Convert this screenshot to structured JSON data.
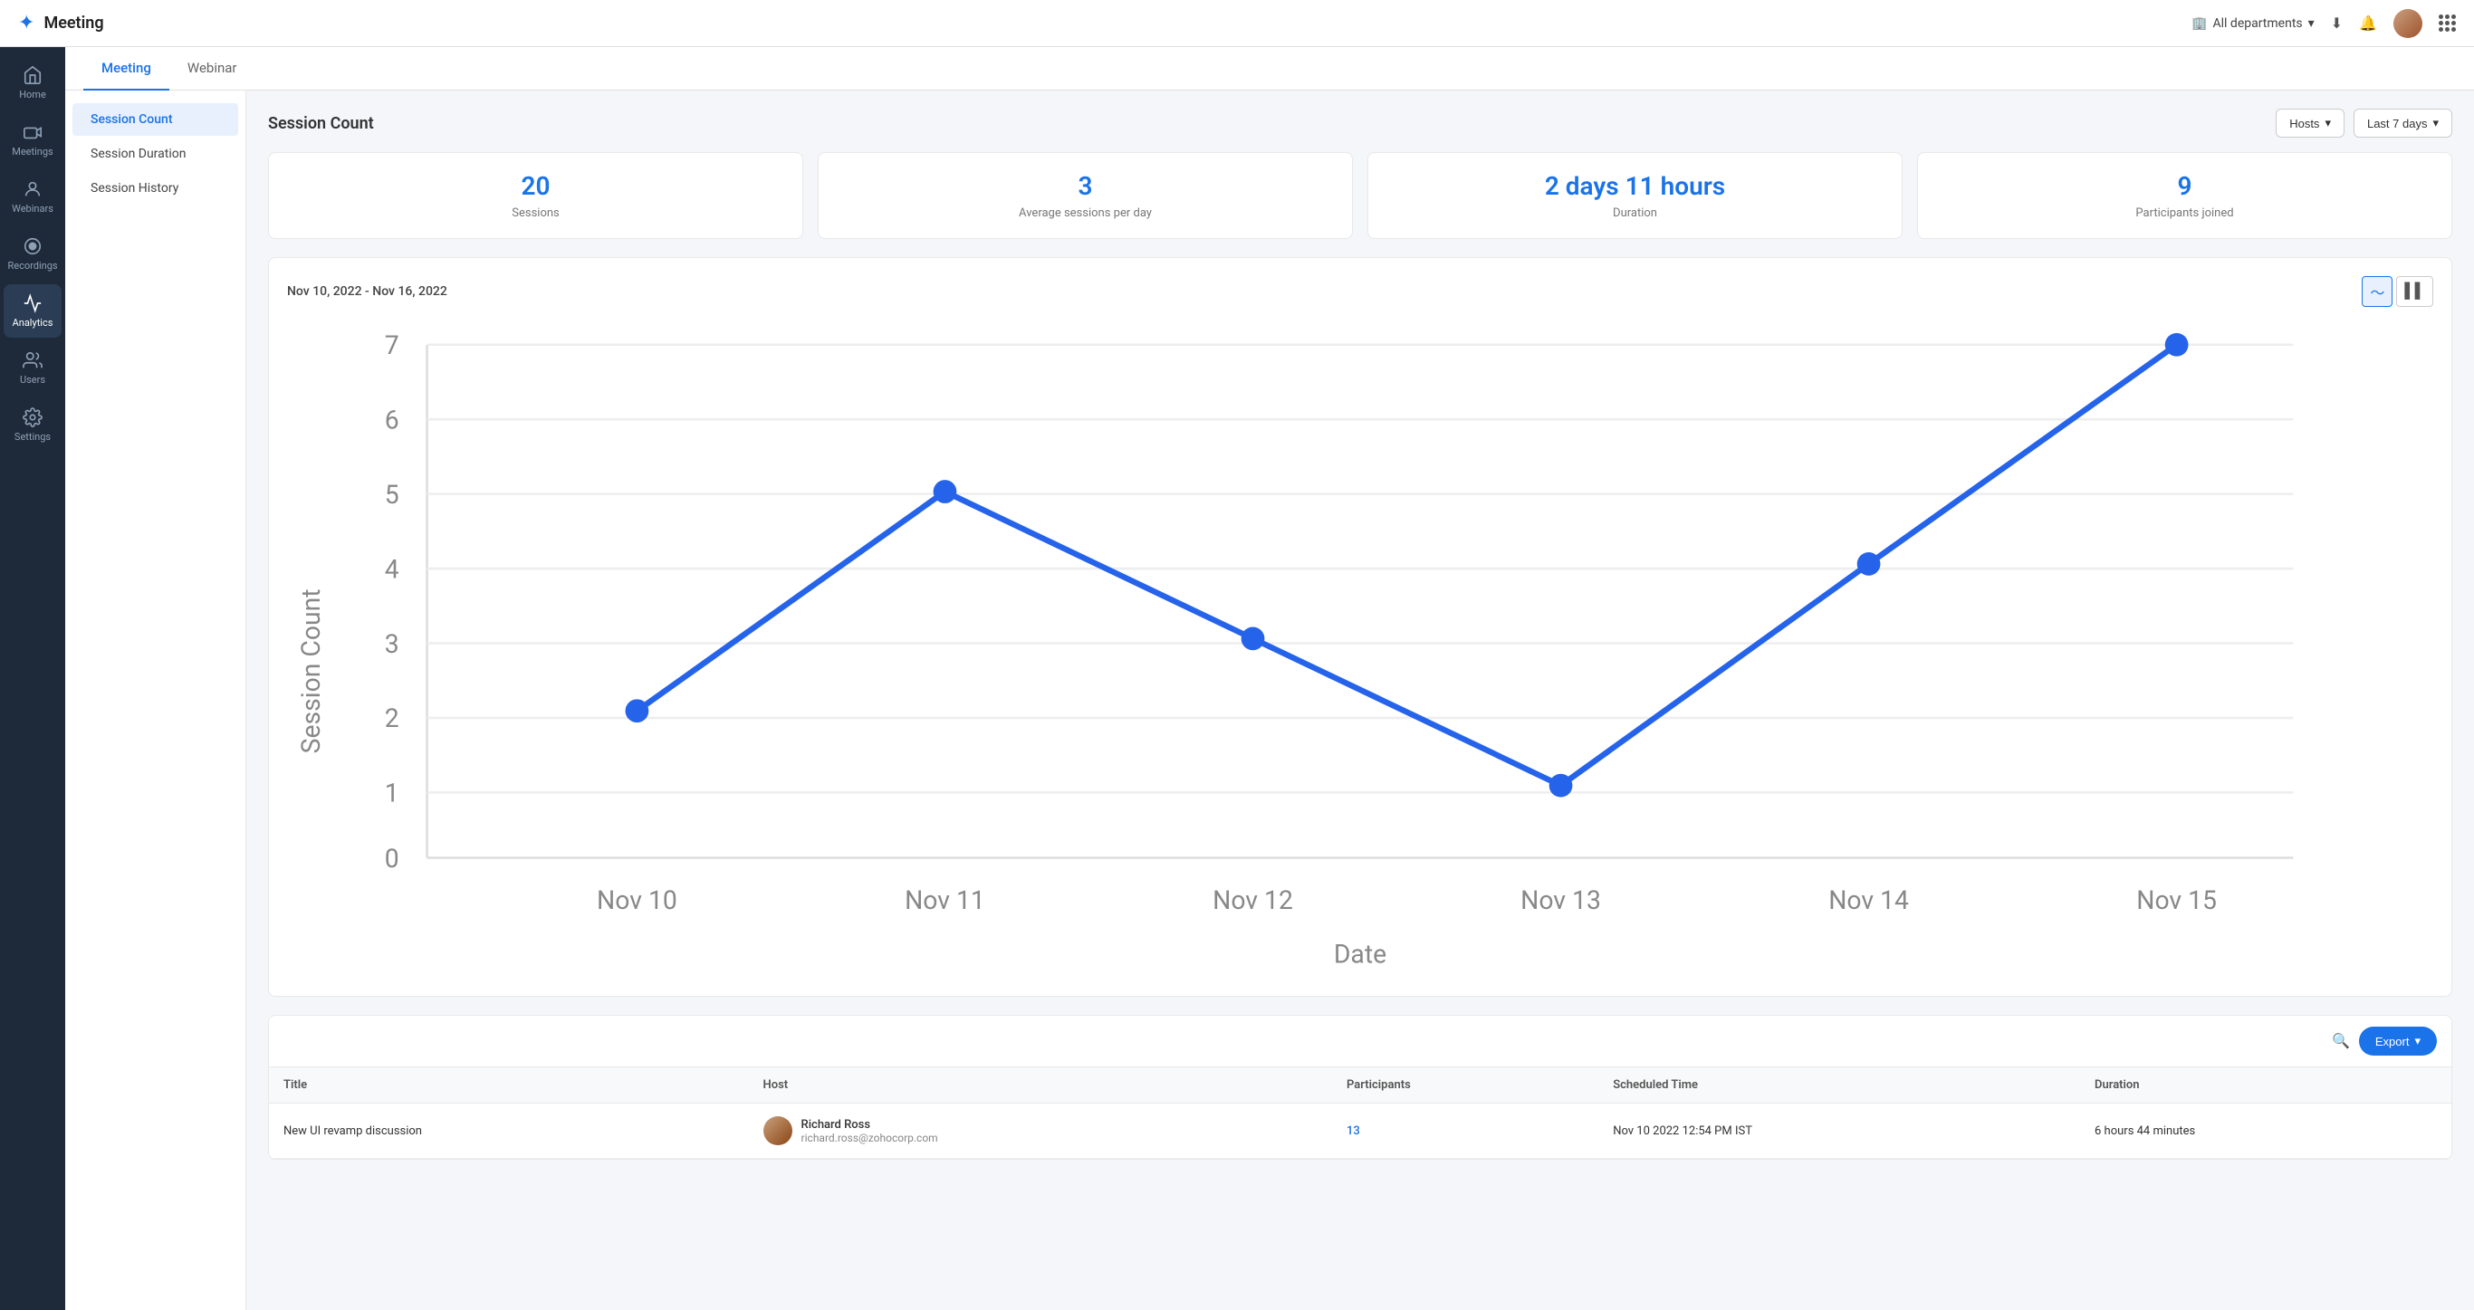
{
  "app": {
    "logo": "✦",
    "title": "Meeting",
    "department": "All departments",
    "download_icon": "⬇",
    "bell_icon": "🔔"
  },
  "sidebar": {
    "items": [
      {
        "id": "home",
        "label": "Home",
        "active": false
      },
      {
        "id": "meetings",
        "label": "Meetings",
        "active": false
      },
      {
        "id": "webinars",
        "label": "Webinars",
        "active": false
      },
      {
        "id": "recordings",
        "label": "Recordings",
        "active": false
      },
      {
        "id": "analytics",
        "label": "Analytics",
        "active": true
      },
      {
        "id": "users",
        "label": "Users",
        "active": false
      },
      {
        "id": "settings",
        "label": "Settings",
        "active": false
      }
    ]
  },
  "tabs": [
    {
      "id": "meeting",
      "label": "Meeting",
      "active": true
    },
    {
      "id": "webinar",
      "label": "Webinar",
      "active": false
    }
  ],
  "left_nav": [
    {
      "id": "session-count",
      "label": "Session Count",
      "active": true
    },
    {
      "id": "session-duration",
      "label": "Session Duration",
      "active": false
    },
    {
      "id": "session-history",
      "label": "Session History",
      "active": false
    }
  ],
  "section": {
    "title": "Session Count",
    "filters": {
      "hosts_label": "Hosts",
      "date_range_label": "Last 7 days"
    }
  },
  "stats": [
    {
      "value": "20",
      "label": "Sessions"
    },
    {
      "value": "3",
      "label": "Average sessions per day"
    },
    {
      "value": "2 days 11 hours",
      "label": "Duration"
    },
    {
      "value": "9",
      "label": "Participants joined"
    }
  ],
  "chart": {
    "date_range": "Nov 10, 2022 - Nov 16, 2022",
    "x_label": "Date",
    "y_label": "Session Count",
    "data_points": [
      {
        "label": "Nov 10",
        "x": 80,
        "y": 2
      },
      {
        "label": "Nov 11",
        "x": 220,
        "y": 5
      },
      {
        "label": "Nov 12",
        "x": 360,
        "y": 3
      },
      {
        "label": "Nov 13",
        "x": 500,
        "y": 1
      },
      {
        "label": "Nov 14",
        "x": 640,
        "y": 4
      },
      {
        "label": "Nov 15",
        "x": 780,
        "y": 7
      }
    ],
    "y_max": 7,
    "y_ticks": [
      0,
      1,
      2,
      3,
      4,
      5,
      6,
      7
    ]
  },
  "table": {
    "export_label": "Export",
    "search_placeholder": "Search...",
    "columns": [
      "Title",
      "Host",
      "Participants",
      "Scheduled Time",
      "Duration"
    ],
    "rows": [
      {
        "title": "New UI revamp discussion",
        "host_name": "Richard Ross",
        "host_email": "richard.ross@zohocorp.com",
        "participants": "13",
        "scheduled_time": "Nov 10 2022 12:54 PM IST",
        "duration": "6 hours 44 minutes"
      }
    ]
  }
}
